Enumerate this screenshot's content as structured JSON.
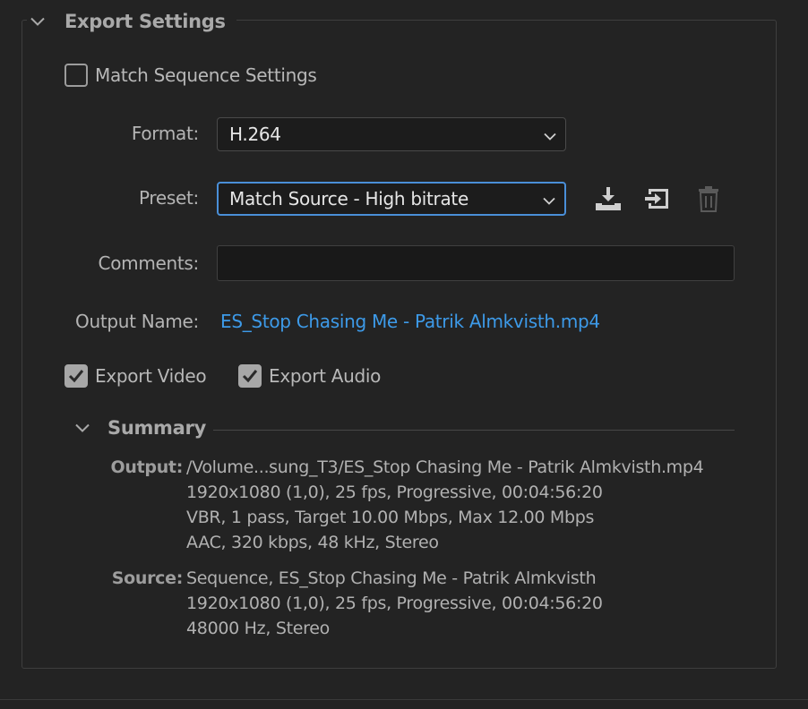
{
  "export_settings": {
    "title": "Export Settings",
    "match_sequence_label": "Match Sequence Settings",
    "match_sequence_checked": false,
    "format_label": "Format:",
    "format_value": "H.264",
    "preset_label": "Preset:",
    "preset_value": "Match Source - High bitrate",
    "comments_label": "Comments:",
    "comments_value": "",
    "output_name_label": "Output Name:",
    "output_name_value": "ES_Stop Chasing Me - Patrik Almkvisth.mp4",
    "export_video_label": "Export Video",
    "export_video_checked": true,
    "export_audio_label": "Export Audio",
    "export_audio_checked": true,
    "preset_icons": [
      "save-preset-icon",
      "import-preset-icon",
      "delete-preset-icon"
    ]
  },
  "summary": {
    "title": "Summary",
    "output_label": "Output:",
    "output_lines": [
      "/Volume...sung_T3/ES_Stop Chasing Me - Patrik Almkvisth.mp4",
      "1920x1080 (1,0), 25 fps, Progressive, 00:04:56:20",
      "VBR, 1 pass, Target 10.00 Mbps, Max 12.00 Mbps",
      "AAC, 320 kbps, 48 kHz, Stereo"
    ],
    "source_label": "Source:",
    "source_lines": [
      "Sequence, ES_Stop Chasing Me - Patrik Almkvisth",
      "1920x1080 (1,0), 25 fps, Progressive, 00:04:56:20",
      "48000 Hz, Stereo"
    ]
  },
  "colors": {
    "background": "#232323",
    "accent_link": "#3d9ae8",
    "focus_border": "#4a8fd8"
  }
}
